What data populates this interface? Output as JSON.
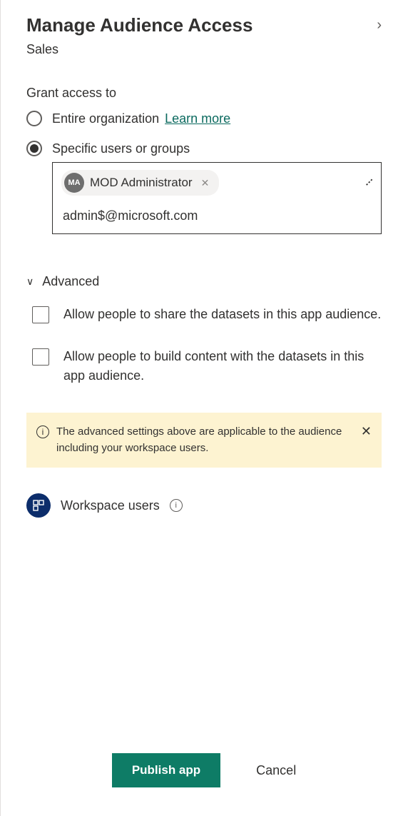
{
  "header": {
    "title": "Manage Audience Access",
    "subtitle": "Sales"
  },
  "grant": {
    "label": "Grant access to",
    "options": {
      "entire": "Entire organization",
      "learn_more": "Learn more",
      "specific": "Specific users or groups"
    },
    "picker": {
      "chip_initials": "MA",
      "chip_name": "MOD Administrator",
      "input_value": "admin$@microsoft.com"
    }
  },
  "advanced": {
    "label": "Advanced",
    "check_share": "Allow people to share the datasets in this app audience.",
    "check_build": "Allow people to build content with the datasets in this app audience.",
    "banner": "The advanced settings above are applicable to the audience including your workspace users."
  },
  "workspace": {
    "label": "Workspace users"
  },
  "footer": {
    "publish": "Publish app",
    "cancel": "Cancel"
  }
}
